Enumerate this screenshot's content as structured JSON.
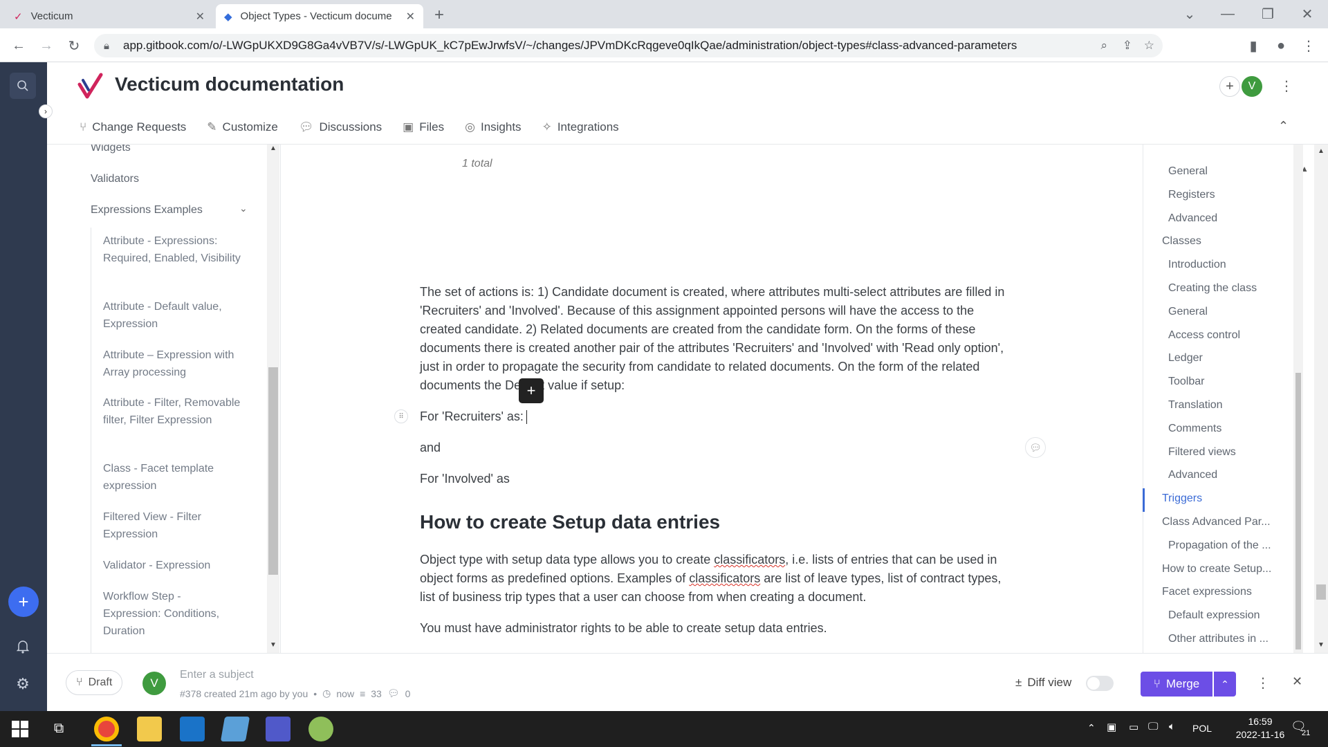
{
  "browser": {
    "tabs": [
      {
        "title": "Vecticum"
      },
      {
        "title": "Object Types - Vecticum docume"
      }
    ],
    "url": "app.gitbook.com/o/-LWGpUKXD9G8Ga4vVB7V/s/-LWGpUK_kC7pEwJrwfsV/~/changes/JPVmDKcRqgeve0qIkQae/administration/object-types#class-advanced-parameters"
  },
  "header": {
    "title": "Vecticum documentation",
    "avatar_letter": "V",
    "nav": [
      {
        "label": "Change Requests"
      },
      {
        "label": "Customize"
      },
      {
        "label": "Discussions"
      },
      {
        "label": "Files"
      },
      {
        "label": "Insights"
      },
      {
        "label": "Integrations"
      }
    ]
  },
  "sidebar": {
    "items": [
      "Widgets",
      "Validators",
      "Expressions Examples"
    ],
    "subitems": [
      "Attribute - Expressions: Required, Enabled, Visibility",
      "Attribute - Default value, Expression",
      "Attribute – Expression with Array processing",
      "Attribute - Filter, Removable filter, Filter Expression",
      "Class - Facet template expression",
      "Filtered View - Filter Expression",
      "Validator - Expression",
      "Workflow Step - Expression: Conditions, Duration"
    ]
  },
  "content": {
    "total": "1 total",
    "paragraph1": "The set of actions is: 1) Candidate document is created, where attributes multi-select attributes are filled in 'Recruiters' and 'Involved'. Because of this assignment appointed persons will have the access to the created candidate. 2) Related documents are created from the candidate form. On the forms of these documents there is created another pair of the attributes 'Recruiters' and 'Involved' with 'Read only option', just in order to propagate the security from candidate to related documents. On the form of the related documents the Default value if setup:",
    "line_recruiters": "For 'Recruiters' as:",
    "line_and": "and",
    "line_involved": "For 'Involved' as",
    "heading": "How to create Setup data entries",
    "p2_part1": "Object type with setup data type allows you to create ",
    "p2_word1": "classificators",
    "p2_part2": ", i.e. lists of entries that can be used in object forms as predefined options. Examples of ",
    "p2_word2": "classificators",
    "p2_part3": " are list of leave types, list of contract types, list of business trip types that a user can choose from when creating a document.",
    "paragraph3": "You must have administrator rights to be able to create setup data entries."
  },
  "toc": [
    {
      "label": "General",
      "indent": true
    },
    {
      "label": "Registers",
      "indent": true
    },
    {
      "label": "Advanced",
      "indent": true
    },
    {
      "label": "Classes",
      "indent": false
    },
    {
      "label": "Introduction",
      "indent": true
    },
    {
      "label": "Creating the class",
      "indent": true
    },
    {
      "label": "General",
      "indent": true
    },
    {
      "label": "Access control",
      "indent": true
    },
    {
      "label": "Ledger",
      "indent": true
    },
    {
      "label": "Toolbar",
      "indent": true
    },
    {
      "label": "Translation",
      "indent": true
    },
    {
      "label": "Comments",
      "indent": true
    },
    {
      "label": "Filtered views",
      "indent": true
    },
    {
      "label": "Advanced",
      "indent": true
    },
    {
      "label": "Triggers",
      "indent": false,
      "active": true
    },
    {
      "label": "Class Advanced Par...",
      "indent": false
    },
    {
      "label": "Propagation of the ...",
      "indent": true
    },
    {
      "label": "How to create Setup...",
      "indent": false
    },
    {
      "label": "Facet expressions",
      "indent": false
    },
    {
      "label": "Default expression",
      "indent": true
    },
    {
      "label": "Other attributes in ...",
      "indent": true
    }
  ],
  "bottom": {
    "draft": "Draft",
    "avatar_letter": "V",
    "subject_placeholder": "Enter a subject",
    "meta": "#378 created 21m ago by you",
    "time": "now",
    "lines": "33",
    "comments": "0",
    "diff_view": "Diff view",
    "merge": "Merge"
  },
  "taskbar": {
    "lang": "POL",
    "time": "16:59",
    "date": "2022-11-16",
    "notif": "21"
  },
  "colors": {
    "accent": "#6c4ee6",
    "rail": "#2f3a4f",
    "link": "#3b6bd6",
    "avatar": "#3f9b3f"
  }
}
